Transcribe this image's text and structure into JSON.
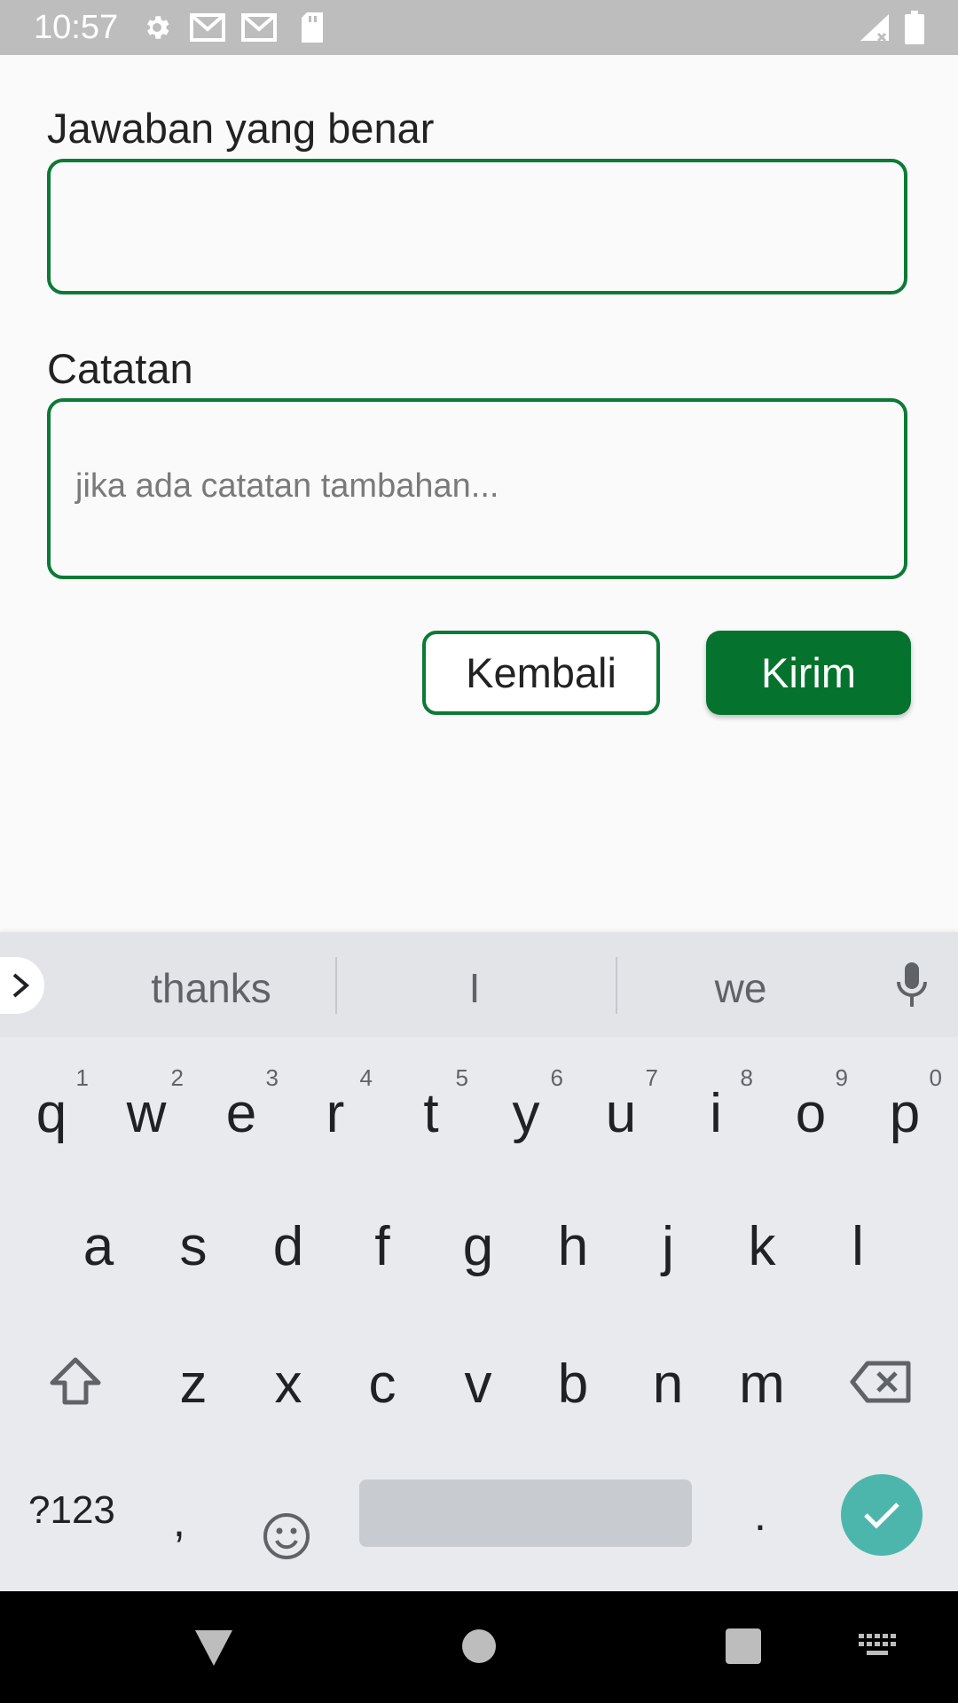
{
  "status_bar": {
    "time": "10:57",
    "icons": [
      "gear-icon",
      "gmail-icon",
      "gmail-icon",
      "sd-card-icon",
      "signal-icon",
      "battery-icon"
    ]
  },
  "form": {
    "correct_answer": {
      "label": "Jawaban yang benar",
      "value": ""
    },
    "notes": {
      "label": "Catatan",
      "placeholder": "jika ada catatan tambahan..."
    },
    "back_label": "Kembali",
    "send_label": "Kirim",
    "accent_color": "#0b7a36"
  },
  "keyboard": {
    "suggestions": [
      "thanks",
      "I",
      "we"
    ],
    "row1": [
      {
        "key": "q",
        "hint": "1"
      },
      {
        "key": "w",
        "hint": "2"
      },
      {
        "key": "e",
        "hint": "3"
      },
      {
        "key": "r",
        "hint": "4"
      },
      {
        "key": "t",
        "hint": "5"
      },
      {
        "key": "y",
        "hint": "6"
      },
      {
        "key": "u",
        "hint": "7"
      },
      {
        "key": "i",
        "hint": "8"
      },
      {
        "key": "o",
        "hint": "9"
      },
      {
        "key": "p",
        "hint": "0"
      }
    ],
    "row2": [
      "a",
      "s",
      "d",
      "f",
      "g",
      "h",
      "j",
      "k",
      "l"
    ],
    "row3": [
      "z",
      "x",
      "c",
      "v",
      "b",
      "n",
      "m"
    ],
    "symbols_label": "?123",
    "comma": ",",
    "period": ".",
    "enter_color": "#4db6ac"
  },
  "nav_bar": {
    "icons": [
      "back-triangle-icon",
      "home-circle-icon",
      "recents-square-icon",
      "keyboard-switch-icon"
    ]
  }
}
